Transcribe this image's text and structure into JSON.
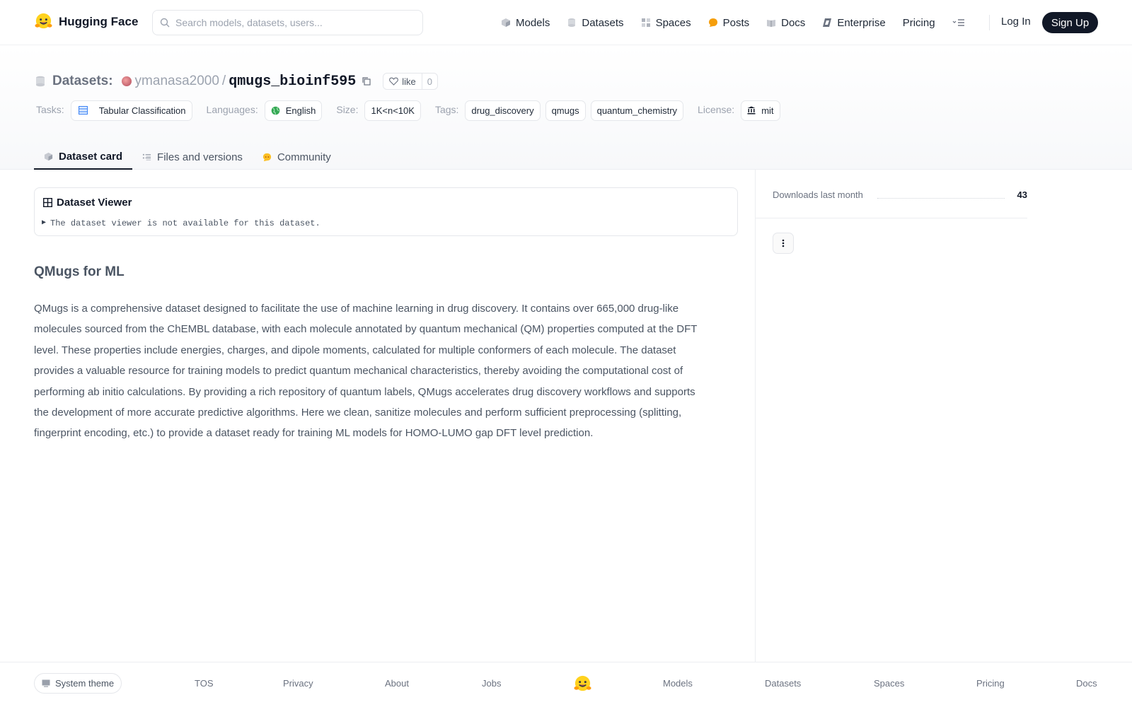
{
  "nav": {
    "brand": "Hugging Face",
    "search_placeholder": "Search models, datasets, users...",
    "links": [
      {
        "label": "Models",
        "icon": "cube-icon"
      },
      {
        "label": "Datasets",
        "icon": "database-icon"
      },
      {
        "label": "Spaces",
        "icon": "grid-icon"
      },
      {
        "label": "Posts",
        "icon": "chat-bubble-icon"
      },
      {
        "label": "Docs",
        "icon": "book-icon"
      },
      {
        "label": "Enterprise",
        "icon": "enterprise-icon"
      },
      {
        "label": "Pricing",
        "icon": ""
      }
    ],
    "login": "Log In",
    "signup": "Sign Up"
  },
  "header": {
    "section": "Datasets:",
    "owner": "ymanasa2000",
    "separator": "/",
    "repo": "qmugs_bioinf595",
    "like_label": "like",
    "like_count": "0",
    "tasks_label": "Tasks:",
    "task": "Tabular Classification",
    "languages_label": "Languages:",
    "language": "English",
    "size_label": "Size:",
    "size": "1K<n<10K",
    "tags_label": "Tags:",
    "tags": [
      "drug_discovery",
      "qmugs",
      "quantum_chemistry"
    ],
    "license_label": "License:",
    "license": "mit"
  },
  "tabs": [
    {
      "label": "Dataset card",
      "active": true
    },
    {
      "label": "Files and versions",
      "active": false
    },
    {
      "label": "Community",
      "active": false
    }
  ],
  "viewer": {
    "title": "Dataset Viewer",
    "message": "The dataset viewer is not available for this dataset."
  },
  "card": {
    "heading": "QMugs for ML",
    "body": "QMugs is a comprehensive dataset designed to facilitate the use of machine learning in drug discovery. It contains over 665,000 drug-like molecules sourced from the ChEMBL database, with each molecule annotated by quantum mechanical (QM) properties computed at the DFT level. These properties include energies, charges, and dipole moments, calculated for multiple conformers of each molecule. The dataset provides a valuable resource for training models to predict quantum mechanical characteristics, thereby avoiding the computational cost of performing ab initio calculations. By providing a rich repository of quantum labels, QMugs accelerates drug discovery workflows and supports the development of more accurate predictive algorithms. Here we clean, sanitize molecules and perform sufficient preprocessing (splitting, fingerprint encoding, etc.) to provide a dataset ready for training ML models for HOMO-LUMO gap DFT level prediction."
  },
  "sidebar": {
    "downloads_label": "Downloads last month",
    "downloads": "43"
  },
  "footer": {
    "theme": "System theme",
    "links": [
      "TOS",
      "Privacy",
      "About",
      "Jobs",
      "Models",
      "Datasets",
      "Spaces",
      "Pricing",
      "Docs"
    ]
  },
  "colors": {
    "accent_dark": "#111827",
    "brand_yellow": "#FFD21E",
    "muted_text": "#6b7280"
  }
}
